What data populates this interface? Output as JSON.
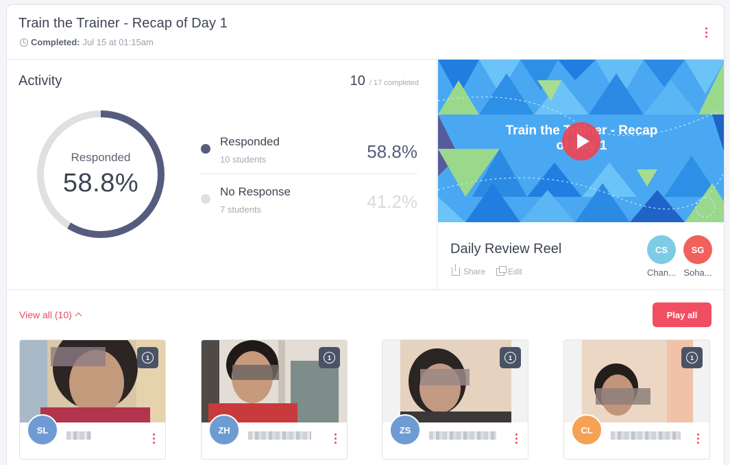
{
  "header": {
    "title": "Train the Trainer - Recap of Day 1",
    "completed_label": "Completed:",
    "completed_value": "Jul 15 at 01:15am"
  },
  "activity": {
    "title": "Activity",
    "completed_count": "10",
    "completed_total": "/ 17 completed",
    "donut": {
      "label": "Responded",
      "value": "58.8%",
      "fraction": 0.588
    },
    "legend": [
      {
        "name": "Responded",
        "sub": "10 students",
        "pct": "58.8%",
        "color": "#565c7d"
      },
      {
        "name": "No Response",
        "sub": "7 students",
        "pct": "41.2%",
        "color": "#e0e0e0"
      }
    ]
  },
  "reel": {
    "thumbnail_title_line1": "Train the Trainer - Recap",
    "thumbnail_title_line2": "of Day 1",
    "name": "Daily Review Reel",
    "share_label": "Share",
    "edit_label": "Edit",
    "collaborators": [
      {
        "initials": "CS",
        "name": "Chan...",
        "color": "#7dcbe4"
      },
      {
        "initials": "SG",
        "name": "Soha...",
        "color": "#f2605c"
      }
    ]
  },
  "responses": {
    "view_all_label": "View all (10)",
    "play_all_label": "Play all",
    "comment_icon": "comment-count-icon",
    "cards": [
      {
        "initials": "SL",
        "avatar_color": "#6f9bd3",
        "comment_count": "1"
      },
      {
        "initials": "ZH",
        "avatar_color": "#6f9bd3",
        "comment_count": "1"
      },
      {
        "initials": "ZS",
        "avatar_color": "#6f9bd3",
        "comment_count": "1"
      },
      {
        "initials": "CL",
        "avatar_color": "#f5a254",
        "comment_count": "1"
      }
    ]
  },
  "colors": {
    "accent": "#e8495a",
    "donut_fill": "#565c7d",
    "donut_track": "#e0e0e0"
  }
}
